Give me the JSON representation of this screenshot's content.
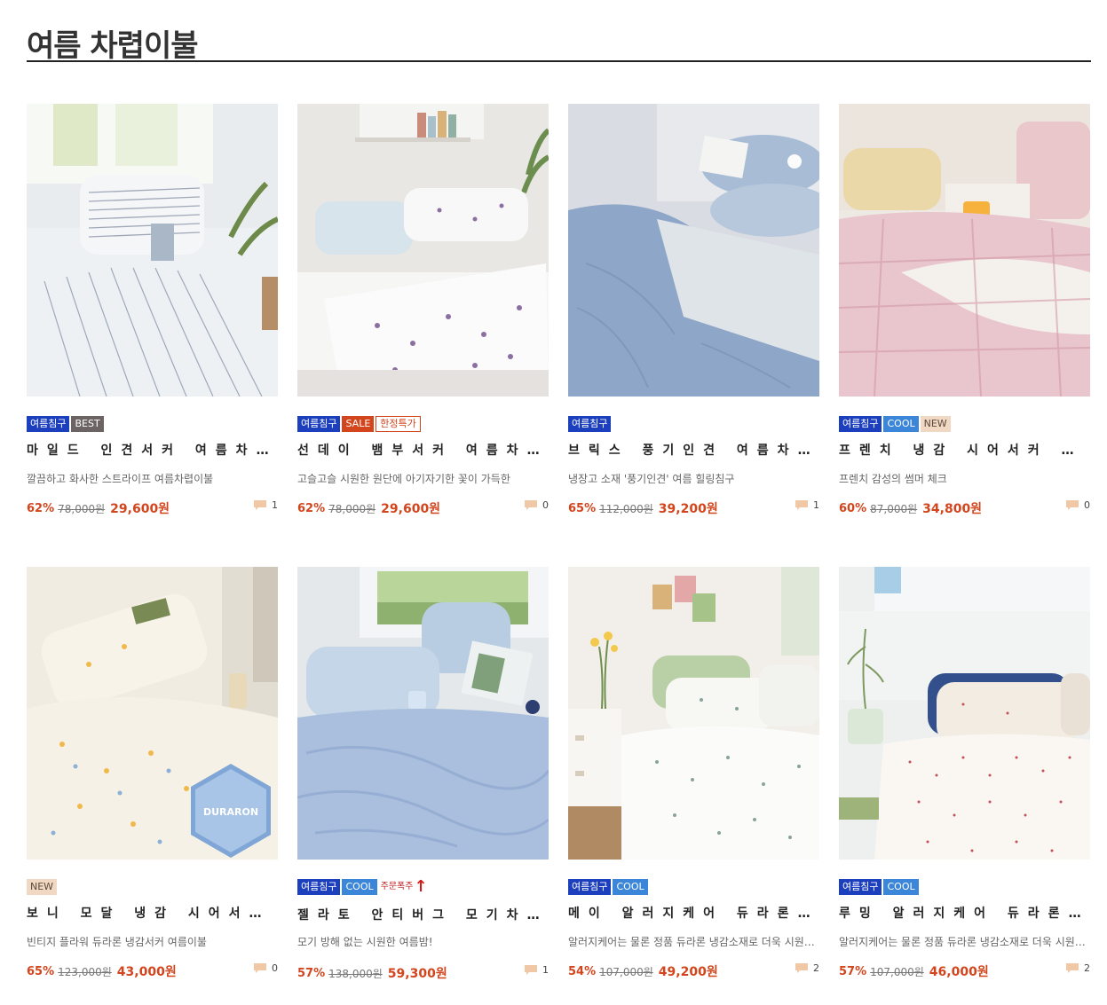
{
  "section": {
    "title": "여름 차렵이불"
  },
  "products": [
    {
      "badges": [
        {
          "text": "여름침구",
          "style": "season"
        },
        {
          "text": "BEST",
          "style": "best"
        }
      ],
      "name": "마일드 인견서커 여름차렵이불",
      "desc": "깔끔하고 화사한 스트라이프 여름차렵이불",
      "discount": "62%",
      "original_price": "78,000원",
      "sale_price": "29,600원",
      "comments": "1"
    },
    {
      "badges": [
        {
          "text": "여름침구",
          "style": "season"
        },
        {
          "text": "SALE",
          "style": "sale"
        },
        {
          "text": "한정특가",
          "style": "limited"
        }
      ],
      "name": "선데이 뱀부서커 여름차렵이불",
      "desc": "고슬고슬 시원한 원단에 아기자기한 꽃이 가득한",
      "discount": "62%",
      "original_price": "78,000원",
      "sale_price": "29,600원",
      "comments": "0"
    },
    {
      "badges": [
        {
          "text": "여름침구",
          "style": "season"
        }
      ],
      "name": "브릭스 풍기인견 여름차렵이불",
      "desc": "냉장고 소재 '풍기인견' 여름 힐링침구",
      "discount": "65%",
      "original_price": "112,000원",
      "sale_price": "39,200원",
      "comments": "1"
    },
    {
      "badges": [
        {
          "text": "여름침구",
          "style": "season"
        },
        {
          "text": "COOL",
          "style": "cool"
        },
        {
          "text": "NEW",
          "style": "new"
        }
      ],
      "name": "프렌치 냉감 시어서커 차렵이불",
      "desc": "프렌치 감성의 썸머 체크",
      "discount": "60%",
      "original_price": "87,000원",
      "sale_price": "34,800원",
      "comments": "0"
    },
    {
      "badges": [
        {
          "text": "NEW",
          "style": "new"
        }
      ],
      "name": "보니 모달 냉감 시어서커 차렵이불",
      "desc": "빈티지 플라워 듀라론 냉감서커 여름이불",
      "discount": "65%",
      "original_price": "123,000원",
      "sale_price": "43,000원",
      "comments": "0"
    },
    {
      "badges": [
        {
          "text": "여름침구",
          "style": "season"
        },
        {
          "text": "COOL",
          "style": "cool"
        },
        {
          "text": "주문폭주",
          "style": "hot"
        }
      ],
      "name": "젤라토 안티버그 모기차단 냉감이불",
      "desc": "모기 방해 없는 시원한 여름밤!",
      "discount": "57%",
      "original_price": "138,000원",
      "sale_price": "59,300원",
      "comments": "1"
    },
    {
      "badges": [
        {
          "text": "여름침구",
          "style": "season"
        },
        {
          "text": "COOL",
          "style": "cool"
        }
      ],
      "name": "메이 알러지케어 듀라론 냉감이불",
      "desc": "알러지케어는 물론 정품 듀라론 냉감소재로 더욱 시원하게",
      "discount": "54%",
      "original_price": "107,000원",
      "sale_price": "49,200원",
      "comments": "2"
    },
    {
      "badges": [
        {
          "text": "여름침구",
          "style": "season"
        },
        {
          "text": "COOL",
          "style": "cool"
        }
      ],
      "name": "루밍 알러지케어 듀라론 냉감이불",
      "desc": "알러지케어는 물론 정품 듀라론 냉감소재로 더욱 시원하게",
      "discount": "57%",
      "original_price": "107,000원",
      "sale_price": "46,000원",
      "comments": "2"
    }
  ],
  "image_labels": {
    "duraron_tag": "DURARON"
  },
  "colors": {
    "accent": "#d2451d",
    "season_badge": "#1c3fbe",
    "cool_badge": "#3b86d9",
    "best_badge": "#6b6462",
    "new_badge": "#f0d8c3"
  }
}
